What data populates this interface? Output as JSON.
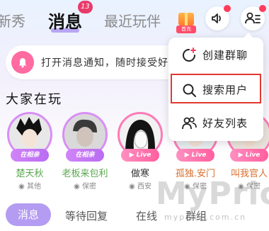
{
  "top_tabs": {
    "new": "新秀",
    "messages": "消息",
    "recent": "最近玩伴"
  },
  "messages_badge": "13",
  "gift_label": "首充",
  "notice": {
    "text": "打开消息通知，随时接受好友消息"
  },
  "section_title": "大家在玩",
  "users": [
    {
      "name": "楚天秋",
      "location": "其他",
      "status": "在相亲",
      "status_type": "room"
    },
    {
      "name": "老板来包利",
      "location": "保密",
      "status": "在相亲",
      "status_type": "room"
    },
    {
      "name": "做寒",
      "location": "西安",
      "status": "Live",
      "status_type": "live"
    },
    {
      "name": "孤独.安门",
      "location": "保密",
      "status": "Live",
      "status_type": "live"
    },
    {
      "name": "叫我官人",
      "location": "保密",
      "status": "Live",
      "status_type": "live"
    }
  ],
  "bottom_tabs": {
    "messages": "消息",
    "waiting": "等待回复",
    "online": "在线",
    "group": "群组"
  },
  "menu": {
    "items": [
      {
        "label": "创建群聊",
        "icon": "create-group-icon"
      },
      {
        "label": "搜索用户",
        "icon": "search-icon"
      },
      {
        "label": "好友列表",
        "icon": "friends-icon"
      }
    ]
  },
  "watermark": {
    "main": "MyPrice",
    "sub": "myprice.com.cn"
  },
  "colors": {
    "accent": "#b39cf1",
    "badge": "#e83a6a",
    "highlight": "#e2392f",
    "bell": "#ff6ba0"
  }
}
